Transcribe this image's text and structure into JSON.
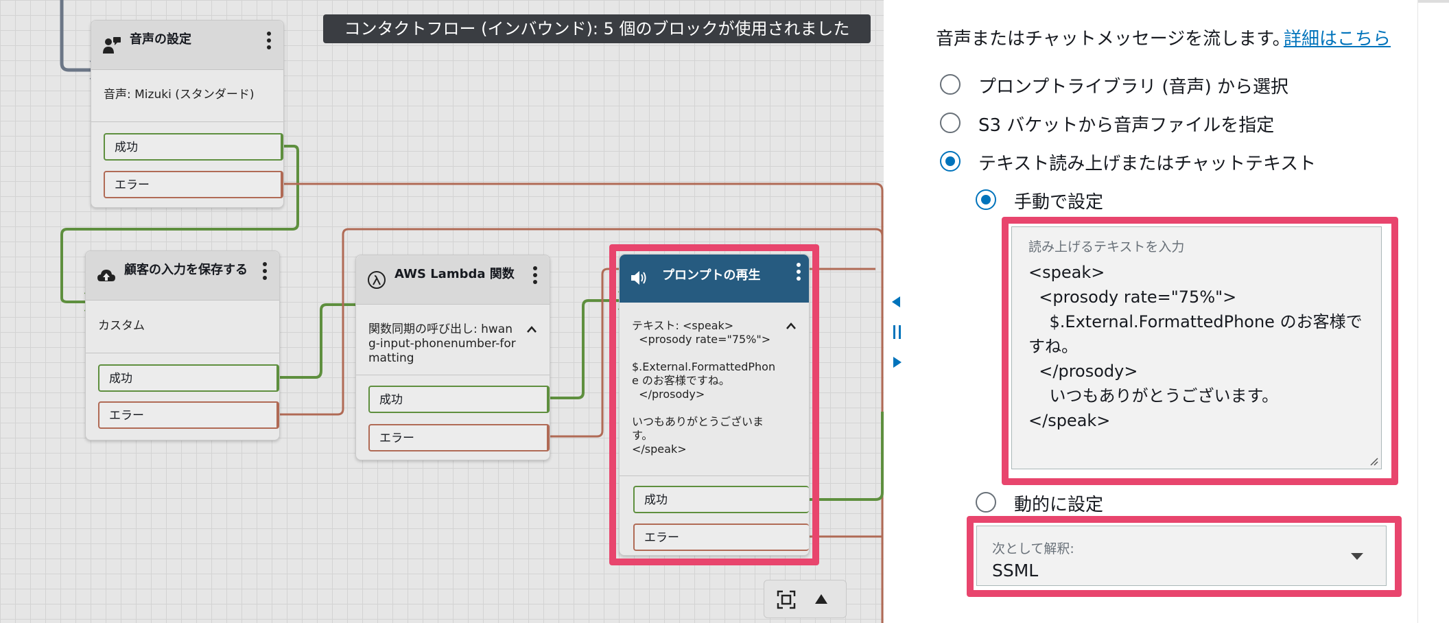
{
  "banner": "コンタクトフロー (インバウンド): 5 個のブロックが使用されました",
  "blocks": {
    "voice": {
      "title": "音声の設定",
      "body": "音声: Mizuki (スタンダード)",
      "success": "成功",
      "error": "エラー"
    },
    "store_input": {
      "title": "顧客の入力を保存する",
      "body": "カスタム",
      "success": "成功",
      "error": "エラー"
    },
    "lambda": {
      "title": "AWS Lambda 関数",
      "body": "関数同期の呼び出し: hwang-input-phonenumber-formatting",
      "success": "成功",
      "error": "エラー"
    },
    "play_prompt": {
      "title": "プロンプトの再生",
      "body": "テキスト: <speak>\n  <prosody rate=\"75%\">\n\n$.External.FormattedPhone のお客様ですね。\n  </prosody>\n\nいつもありがとうございます。\n</speak>",
      "success": "成功",
      "error": "エラー"
    }
  },
  "panel": {
    "description": "音声またはチャットメッセージを流します。",
    "learn_more": "詳細はこちら",
    "options": {
      "library": "プロンプトライブラリ (音声) から選択",
      "s3": "S3 バケットから音声ファイルを指定",
      "tts": "テキスト読み上げまたはチャットテキスト"
    },
    "manual": "手動で設定",
    "textarea_label": "読み上げるテキストを入力",
    "textarea_value": "<speak>\n  <prosody rate=\"75%\">\n    $.External.FormattedPhone のお客様ですね。\n  </prosody>\n    いつもありがとうございます。\n</speak>",
    "dynamic": "動的に設定",
    "interpret_label": "次として解釈:",
    "interpret_value": "SSML"
  },
  "colors": {
    "success": "#5e8f3e",
    "error": "#b06a55",
    "highlight": "#e8456d",
    "selected_header": "#265b80",
    "accent": "#0073bb"
  },
  "icons": [
    "voice-settings-icon",
    "cloud-upload-icon",
    "lambda-icon",
    "speaker-icon",
    "kebab-menu-icon",
    "chevron-up-icon",
    "fit-to-screen-icon",
    "triangle-up-icon",
    "chevron-down-icon",
    "collapse-left-icon",
    "pause-handle-icon",
    "expand-right-icon"
  ]
}
